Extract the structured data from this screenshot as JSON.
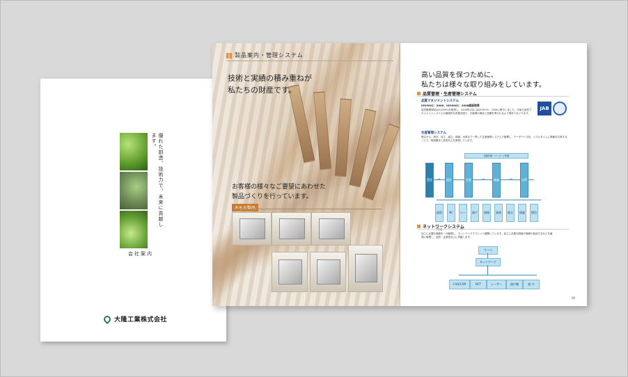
{
  "cover": {
    "vertical_text": "優れた創造、技術力で、未来に貢献します。",
    "label": "会社案内",
    "company": "大隆工業株式会社"
  },
  "spread": {
    "header": "製品案内・管理システム",
    "headline_1a": "技術と実績の積み重ねが",
    "headline_1b": "私たちの財産です。",
    "headline_2a": "お客様の様々なご要望にあわせた",
    "headline_2b": "製品づくりを行っています。",
    "products_label": "おもな製品"
  },
  "right": {
    "title_a": "高い品質を保つために、",
    "title_b": "私たちは様々な取り組みをしています。",
    "sec1": "品質管理・生産管理システム",
    "sub1": "品質マネジメントシステム",
    "sub1b": "ISO9001：2000、ISO9001：2008認証取得",
    "body1": "品質管理体制はISO9001を取得し、2008年5月にはISO9001：2008に移行しました。今後も品質マネジメントシステムの継続的な改善を図り、お客様の満足と信頼を得られるよう努めてまいります。",
    "cert1": "JAB",
    "sub2": "生産管理システム",
    "body2": "受注から、設計、加工、組立、検査、出荷まで一貫した生産管理システムで管理し、データベース化、リアルタイムに情報を共有することで、短納期化と品質向上を実現しています。",
    "flow_top": "図面管理・バーコード管理",
    "flow": [
      "受注",
      "設計",
      "生産",
      "検査",
      "出荷"
    ],
    "flow_sub": [
      "図面作成",
      "NC",
      "レーザー",
      "曲げ",
      "溶接",
      "塗装",
      "組立",
      "検査",
      "梱包"
    ],
    "sec2": "ネットワークシステム",
    "body3": "加工に必要な情報を一元管理し、ネットワークでマシンへ展開しています。加工に必要な図面や情報や製品寸法などを最適に管理し、品質・生産性向上に貢献します。",
    "net_top": "サーバ",
    "net_mid": "ネットワーク",
    "net_nodes": [
      "CAD/CAM",
      "NCT",
      "レーザー",
      "曲げ機",
      "曲 げ"
    ],
    "page_no": "06"
  }
}
